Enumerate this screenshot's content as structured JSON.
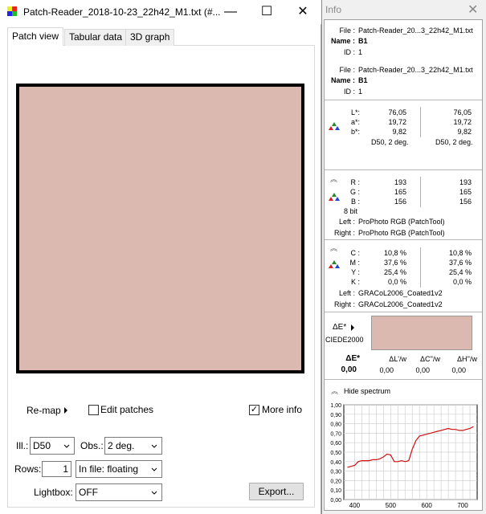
{
  "window": {
    "title": "Patch-Reader_2018-10-23_22h42_M1.txt (#...",
    "minimize_glyph": "—",
    "maximize_glyph": "☐",
    "close_glyph": "✕"
  },
  "tabs": [
    {
      "label": "Patch view"
    },
    {
      "label": "Tabular data"
    },
    {
      "label": "3D graph"
    }
  ],
  "patch": {
    "color": "#dbb8b0"
  },
  "controls": {
    "remap_label": "Re-map",
    "edit_patches_label": "Edit patches",
    "edit_patches_checked": false,
    "more_info_label": "More info",
    "more_info_checked": true,
    "check_glyph": "✓",
    "ill_label": "Ill.:",
    "ill_value": "D50",
    "obs_label": "Obs.:",
    "obs_value": "2 deg.",
    "rows_label": "Rows:",
    "rows_value": "1",
    "infile_value": "In file: floating",
    "lightbox_label": "Lightbox:",
    "lightbox_value": "OFF",
    "export_label": "Export..."
  },
  "info": {
    "title": "Info",
    "close_glyph": "✕",
    "file_label": "File :",
    "name_label": "Name :",
    "id_label": "ID :",
    "entries": [
      {
        "file": "Patch-Reader_20...3_22h42_M1.txt",
        "name": "B1",
        "id": "1"
      },
      {
        "file": "Patch-Reader_20...3_22h42_M1.txt",
        "name": "B1",
        "id": "1"
      }
    ],
    "lab": {
      "labels": [
        "L*:",
        "a*:",
        "b*:"
      ],
      "left": [
        "76,05",
        "19,72",
        "9,82"
      ],
      "right": [
        "76,05",
        "19,72",
        "9,82"
      ],
      "cond_left": "D50, 2 deg.",
      "cond_right": "D50, 2 deg."
    },
    "rgb": {
      "labels": [
        "R :",
        "G :",
        "B :"
      ],
      "left": [
        "193",
        "165",
        "156"
      ],
      "right": [
        "193",
        "165",
        "156"
      ],
      "bits": "8 bit",
      "left_label": "Left :",
      "left_profile": "ProPhoto RGB (PatchTool)",
      "right_label": "Right :",
      "right_profile": "ProPhoto RGB (PatchTool)"
    },
    "cmyk": {
      "labels": [
        "C :",
        "M :",
        "Y :",
        "K :"
      ],
      "left": [
        "10,8 %",
        "37,6 %",
        "25,4 %",
        "0,0 %"
      ],
      "right": [
        "10,8 %",
        "37,6 %",
        "25,4 %",
        "0,0 %"
      ],
      "left_label": "Left :",
      "left_profile": "GRACoL2006_Coated1v2",
      "right_label": "Right :",
      "right_profile": "GRACoL2006_Coated1v2"
    },
    "delta": {
      "title": "ΔE*",
      "formula": "CIEDE2000",
      "swatch_color": "#dbb8b0",
      "headers": [
        "ΔE*",
        "ΔL'/w",
        "ΔC''/w",
        "ΔH''/w"
      ],
      "values": [
        "0,00",
        "0,00",
        "0,00",
        "0,00"
      ]
    },
    "spectrum_toggle": "Hide spectrum"
  },
  "chart_data": {
    "type": "line",
    "title": "",
    "xlabel": "",
    "ylabel": "",
    "xlim": [
      370,
      740
    ],
    "ylim": [
      0,
      1
    ],
    "x_ticks": [
      400,
      500,
      600,
      700
    ],
    "y_ticks": [
      0.0,
      0.1,
      0.2,
      0.3,
      0.4,
      0.5,
      0.6,
      0.7,
      0.8,
      0.9,
      1.0
    ],
    "y_tick_labels": [
      "0,00",
      "0,10",
      "0,20",
      "0,30",
      "0,40",
      "0,50",
      "0,60",
      "0,70",
      "0,80",
      "0,90",
      "1,00"
    ],
    "grid": true,
    "line_color": "#d01010",
    "series": [
      {
        "x": [
          380,
          390,
          400,
          410,
          420,
          430,
          440,
          450,
          460,
          470,
          480,
          490,
          500,
          510,
          520,
          530,
          540,
          550,
          560,
          570,
          580,
          590,
          600,
          610,
          620,
          630,
          640,
          650,
          660,
          670,
          680,
          690,
          700,
          710,
          720,
          730
        ],
        "y": [
          0.34,
          0.35,
          0.36,
          0.4,
          0.41,
          0.41,
          0.41,
          0.42,
          0.42,
          0.43,
          0.45,
          0.48,
          0.47,
          0.4,
          0.4,
          0.41,
          0.4,
          0.41,
          0.53,
          0.62,
          0.67,
          0.68,
          0.69,
          0.7,
          0.71,
          0.72,
          0.73,
          0.74,
          0.75,
          0.74,
          0.74,
          0.73,
          0.73,
          0.74,
          0.75,
          0.77
        ]
      }
    ]
  }
}
